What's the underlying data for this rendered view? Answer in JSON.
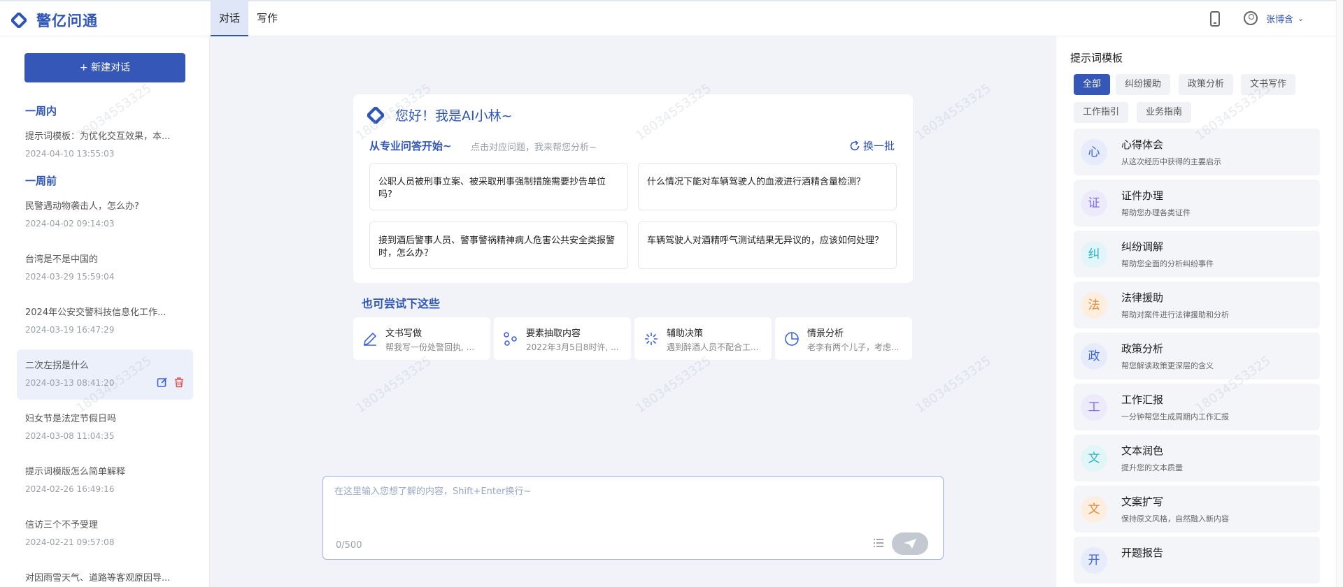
{
  "app": {
    "name": "警亿问通",
    "brand_color": "#2f55b5"
  },
  "header": {
    "tabs": [
      {
        "label": "对话",
        "active": true
      },
      {
        "label": "写作",
        "active": false
      }
    ],
    "user_name": "张博含",
    "icons": [
      "phone-icon",
      "user-icon",
      "chevron-down-icon"
    ]
  },
  "sidebar": {
    "new_chat_label": "+ 新建对话",
    "groups": [
      {
        "title": "一周内"
      },
      {
        "title": "一周前"
      }
    ],
    "conversations": [
      {
        "title": "提示词模板：为优化交互效果，本...",
        "time": "2024-04-10 13:55:03"
      },
      {
        "title": "民警遇动物袭击人，怎么办?",
        "time": "2024-04-02 09:14:03"
      },
      {
        "title": "台湾是不是中国的",
        "time": "2024-03-29 15:59:04"
      },
      {
        "title": "2024年公安交警科技信息化工作...",
        "time": "2024-03-19 16:47:29"
      },
      {
        "title": "二次左拐是什么",
        "time": "2024-03-13 08:41:20",
        "active": true
      },
      {
        "title": "妇女节是法定节假日吗",
        "time": "2024-03-08 11:04:35"
      },
      {
        "title": "提示词模版怎么简单解释",
        "time": "2024-02-26 16:49:16"
      },
      {
        "title": "信访三个不予受理",
        "time": "2024-02-21 09:57:08"
      },
      {
        "title": "对因雨雪天气、道路等客观原因导...",
        "time": ""
      }
    ]
  },
  "main": {
    "greeting": "您好！我是AI小林~",
    "start_label": "从专业问答开始~",
    "start_hint": "点击对应问题，我来帮您分析~",
    "refresh_label": "换一批",
    "questions": [
      "公职人员被刑事立案、被采取刑事强制措施需要抄告单位吗?",
      "什么情况下能对车辆驾驶人的血液进行酒精含量检测？",
      "接到酒后警事人员、警事警祸精神病人危害公共安全类报警时，怎么办？",
      "车辆驾驶人对酒精呼气测试结果无异议的，应该如何处理？"
    ],
    "also_title": "也可尝试下这些",
    "tools": [
      {
        "title": "文书写做",
        "sub": "帮我写一份处警回执, ...",
        "icon": "pen-icon"
      },
      {
        "title": "要素抽取内容",
        "sub": "2022年3月5日8时许, ...",
        "icon": "extract-icon"
      },
      {
        "title": "辅助决策",
        "sub": "遇到醉酒人员不配合工...",
        "icon": "sparkle-icon"
      },
      {
        "title": "情景分析",
        "sub": "老李有两个儿子，考虑...",
        "icon": "pie-icon"
      }
    ],
    "input_placeholder": "在这里输入您想了解的内容，Shift+Enter换行~",
    "counter": "0/500"
  },
  "right_panel": {
    "title": "提示词模板",
    "filters": [
      {
        "label": "全部",
        "active": true
      },
      {
        "label": "纠纷援助"
      },
      {
        "label": "政策分析"
      },
      {
        "label": "文书写作"
      },
      {
        "label": "工作指引"
      },
      {
        "label": "业务指南"
      }
    ],
    "templates": [
      {
        "badge": "心",
        "title": "心得体会",
        "sub": "从这次经历中获得的主要启示",
        "color": "#3d63d8",
        "bg": "#e6ecfb"
      },
      {
        "badge": "证",
        "title": "证件办理",
        "sub": "帮助您办理各类证件",
        "color": "#7f6de4",
        "bg": "#eeeafd"
      },
      {
        "badge": "纠",
        "title": "纠纷调解",
        "sub": "帮助您全面的分析纠纷事件",
        "color": "#2cb4c9",
        "bg": "#e2f5f8"
      },
      {
        "badge": "法",
        "title": "法律援助",
        "sub": "帮助对案件进行法律援助和分析",
        "color": "#e98a34",
        "bg": "#fdeee0"
      },
      {
        "badge": "政",
        "title": "政策分析",
        "sub": "帮您解读政策更深层的含义",
        "color": "#3d63d8",
        "bg": "#e6ecfb"
      },
      {
        "badge": "工",
        "title": "工作汇报",
        "sub": "一分钟帮您生成周期内工作汇报",
        "color": "#7f6de4",
        "bg": "#eeeafd"
      },
      {
        "badge": "文",
        "title": "文本润色",
        "sub": "提升您的文本质量",
        "color": "#2cb4c9",
        "bg": "#e2f5f8"
      },
      {
        "badge": "文",
        "title": "文案扩写",
        "sub": "保持原文风格，自然融入新内容",
        "color": "#e98a34",
        "bg": "#fdeee0"
      },
      {
        "badge": "开",
        "title": "开题报告",
        "sub": "",
        "color": "#3d63d8",
        "bg": "#e6ecfb"
      }
    ]
  },
  "watermark": "18034553325"
}
